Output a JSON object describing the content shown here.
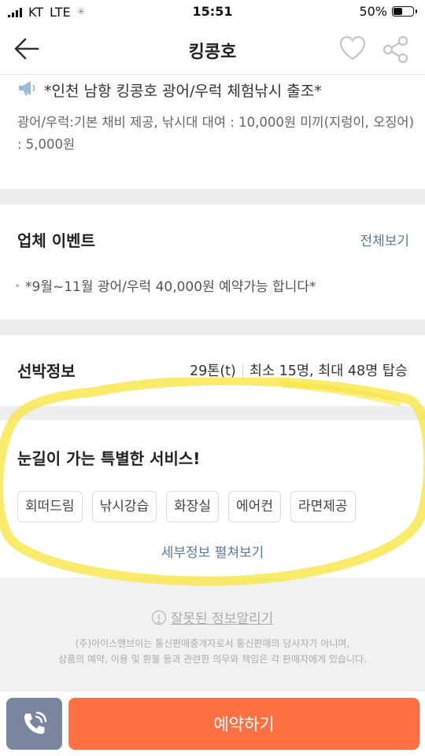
{
  "status_bar": {
    "carrier": "KT",
    "network": "LTE",
    "time": "15:51",
    "battery_percent": "50%",
    "battery_level": 0.5
  },
  "nav": {
    "title": "킹콩호",
    "icons": [
      "back-arrow-icon",
      "heart-icon",
      "share-icon"
    ]
  },
  "notice": {
    "icon": "megaphone-icon",
    "headline": "*인천 남항 킹콩호 광어/우럭 체험낚시 출조*",
    "body": "광어/우럭:기본 채비 제공, 낚시대 대여 : 10,000원 미끼(지렁이, 오징어) : 5,000원"
  },
  "events": {
    "title": "업체 이벤트",
    "see_all": "전체보기",
    "item": "*9월~11월 광어/우럭 40,000원 예약가능  합니다*"
  },
  "ship_info": {
    "title": "선박정보",
    "tonnage": "29톤(t)",
    "capacity": "최소 15명, 최대 48명 탑승"
  },
  "services": {
    "title": "눈길이 가는 특별한 서비스!",
    "tags": [
      "회떠드림",
      "낚시강습",
      "화장실",
      "에어컨",
      "라면제공"
    ],
    "expand_link": "세부정보 펼쳐보기"
  },
  "footer": {
    "report_link": "잘못된 정보알리기",
    "disclaimer_line1": "(주)아이스앤브이는 통신판매중개자로서 통신판매의 당사자가 아니며,",
    "disclaimer_line2": "상품의 예약, 이용 및 환불 등과 관련한 의무와 책임은 각 판매자에게 있습니다."
  },
  "bottom_bar": {
    "call_icon": "phone-icon",
    "reserve_label": "예약하기"
  },
  "colors": {
    "accent_orange": "#ff7043",
    "call_button": "#7a86a0",
    "link_blue": "#5a7a9e",
    "highlight_yellow": "#f7e43a"
  }
}
